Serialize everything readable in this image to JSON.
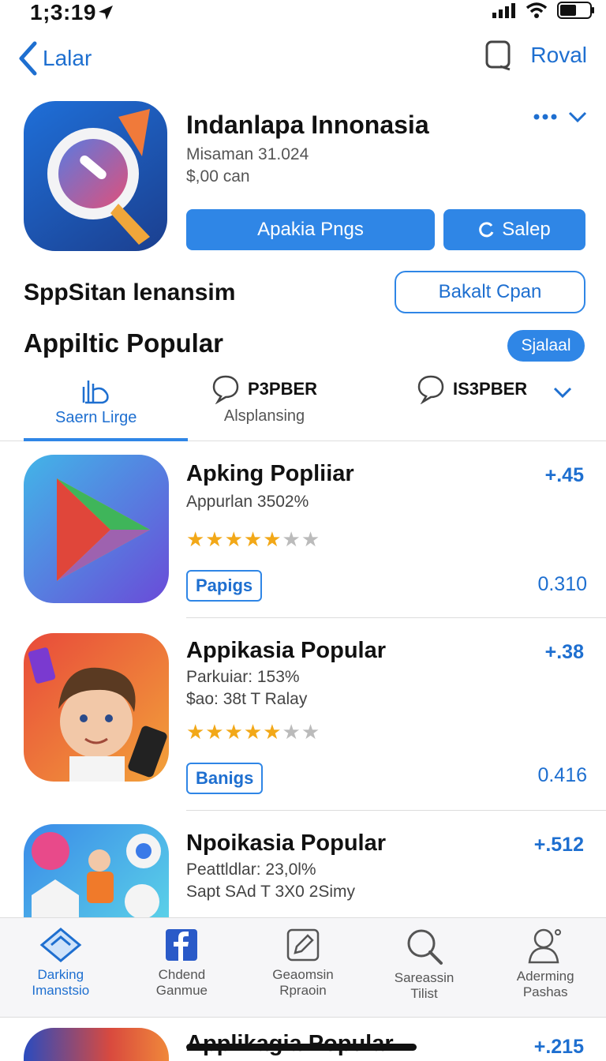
{
  "status": {
    "time": "1;3:19"
  },
  "nav": {
    "back_label": "Lalar",
    "right_label": "Roval"
  },
  "hero": {
    "title": "Indanlapa Innonasia",
    "subtitle1": "Misaman 31.024",
    "subtitle2": "$,00 can",
    "primary_button": "Apakia Pngs",
    "secondary_button": "Salep"
  },
  "section1": {
    "title": "SppSitan lenansim",
    "button": "Bakalt Cpan"
  },
  "section2": {
    "title": "Appiltic Popular",
    "pill": "Sjalaal"
  },
  "tabs": [
    {
      "label": "Saern Lirge"
    },
    {
      "heading": "P3PBER",
      "label": "Alsplansing"
    },
    {
      "heading": "IS3PBER"
    }
  ],
  "items": [
    {
      "title": "Apking Popliiar",
      "sub1": "Appurlan 3502%",
      "sub2": "",
      "price": "+.45",
      "stars": 5,
      "badge": "Papigs",
      "score": "0.310"
    },
    {
      "title": "Appikasia Popular",
      "sub1": "Parkuiar: 153%",
      "sub2": "$ao: 38t  T  Ralay",
      "price": "+.38",
      "stars": 5,
      "badge": "Banigs",
      "score": "0.416"
    },
    {
      "title": "Npoikasia Popular",
      "sub1": "Peattldlar: 23,0l%",
      "sub2": "Sapt SAd  T  3X0  2Simy",
      "price": "+.512"
    }
  ],
  "tabbar": [
    {
      "label1": "Darking",
      "label2": "Imanstsio"
    },
    {
      "label1": "Chdend",
      "label2": "Ganmue"
    },
    {
      "label1": "Geaomsin",
      "label2": "Rpraoin"
    },
    {
      "label1": "Sareassin",
      "label2": "Tilist"
    },
    {
      "label1": "Aderming",
      "label2": "Pashas"
    }
  ],
  "last_item": {
    "title": "Applikagia Popular",
    "price": "+.215"
  },
  "colors": {
    "accent": "#2f86e6",
    "star": "#f2a818",
    "text": "#111111"
  }
}
